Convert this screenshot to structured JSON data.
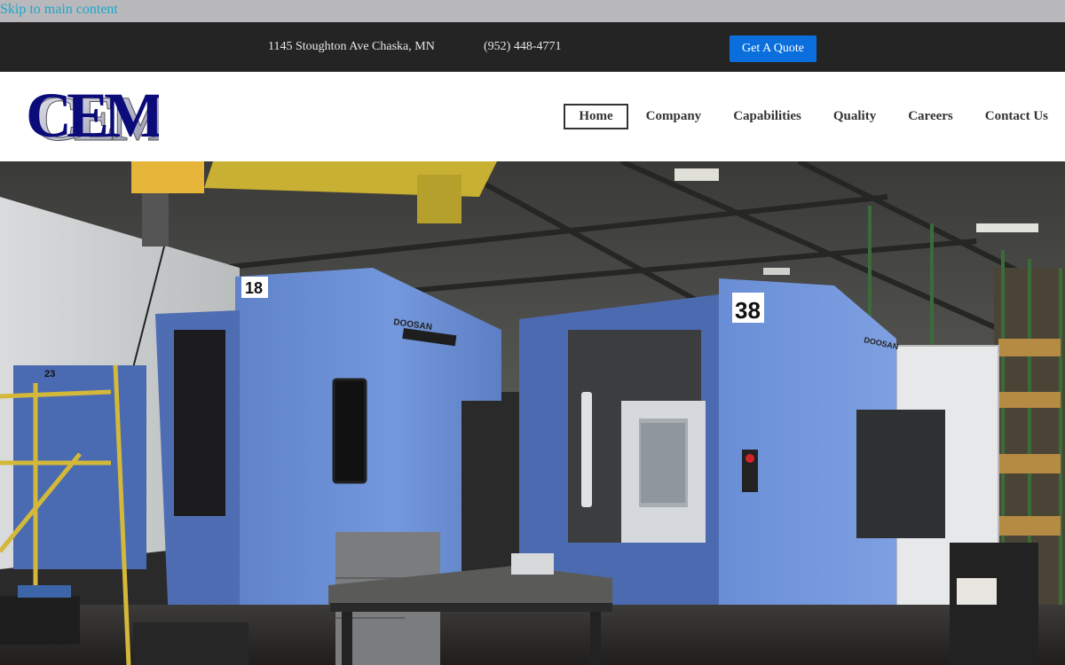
{
  "skip_link": "Skip to main content",
  "topbar": {
    "address": "1145 Stoughton Ave Chaska, MN",
    "phone": "(952) 448-4771",
    "quote_button": "Get A Quote"
  },
  "logo": {
    "text": "CEM"
  },
  "nav": {
    "items": [
      {
        "label": "Home",
        "active": true
      },
      {
        "label": "Company"
      },
      {
        "label": "Capabilities"
      },
      {
        "label": "Quality"
      },
      {
        "label": "Careers"
      },
      {
        "label": "Contact Us"
      }
    ]
  },
  "hero": {
    "machine_left_number": "18",
    "machine_right_number": "38",
    "machine_back_number": "23",
    "machine_brand": "DOOSAN"
  },
  "colors": {
    "accent": "#0a6fdc",
    "skip_link": "#1aa7c8",
    "topbar_bg": "#242424",
    "logo_blue": "#0b0b7a",
    "machine_blue": "#6b8fd6"
  }
}
